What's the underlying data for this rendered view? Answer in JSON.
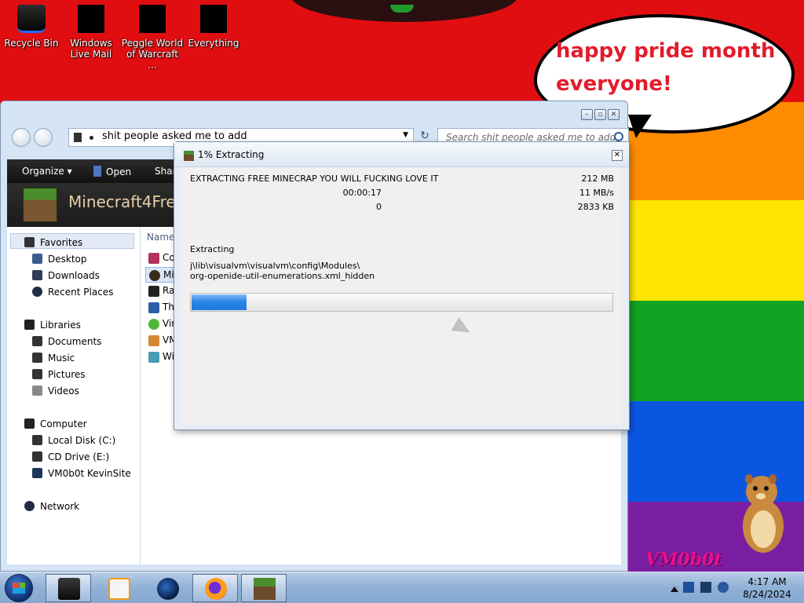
{
  "desktop": {
    "icons": [
      {
        "label": "Recycle Bin"
      },
      {
        "label": "Windows Live Mail"
      },
      {
        "label": "Peggle World of Warcraft ..."
      },
      {
        "label": "Everything"
      }
    ],
    "speech_bubble": "happy pride month everyone!",
    "wallpaper_signature": "VM0b0t",
    "colors": {
      "red": "#e10e11",
      "orange": "#ff8c00",
      "yellow": "#ffe500",
      "green": "#11a322",
      "blue": "#0b56e0",
      "purple": "#7a1fa2"
    }
  },
  "explorer": {
    "address": "shit people asked me to add",
    "search_placeholder": "Search shit people asked me to add",
    "toolbar": {
      "organize": "Organize ▾",
      "open": "Open",
      "share": "Shar"
    },
    "header_title": "Minecraft4Free",
    "nav": {
      "favorites": "Favorites",
      "desktop": "Desktop",
      "downloads": "Downloads",
      "recent": "Recent Places",
      "libraries": "Libraries",
      "documents": "Documents",
      "music": "Music",
      "pictures": "Pictures",
      "videos": "Videos",
      "computer": "Computer",
      "local_disk": "Local Disk (C:)",
      "cd_drive": "CD Drive (E:)",
      "vm_site": "VM0b0t KevinSite",
      "network": "Network"
    },
    "column_name": "Name",
    "files": [
      {
        "label": "Co",
        "icon": "app-icon"
      },
      {
        "label": "Mi",
        "icon": "minecraft-icon"
      },
      {
        "label": "Ra",
        "icon": "app-icon"
      },
      {
        "label": "Th",
        "icon": "app-icon"
      },
      {
        "label": "Vir",
        "icon": "virus-icon"
      },
      {
        "label": "VM",
        "icon": "app-icon"
      },
      {
        "label": "Wi",
        "icon": "app-icon"
      }
    ]
  },
  "dialog": {
    "title": "1% Extracting",
    "archive_line": "EXTRACTING FREE MINECRAP YOU WILL FUCKING LOVE IT",
    "size": "212 MB",
    "elapsed": "00:00:17",
    "speed": "11 MB/s",
    "errors": "0",
    "processed": "2833 KB",
    "status_label": "Extracting",
    "path_line1": "j\\lib\\visualvm\\visualvm\\config\\Modules\\",
    "path_line2": "org-openide-util-enumerations.xml_hidden",
    "progress_fraction": 0.13
  },
  "taskbar": {
    "time": "4:17 AM",
    "date": "8/24/2024"
  }
}
